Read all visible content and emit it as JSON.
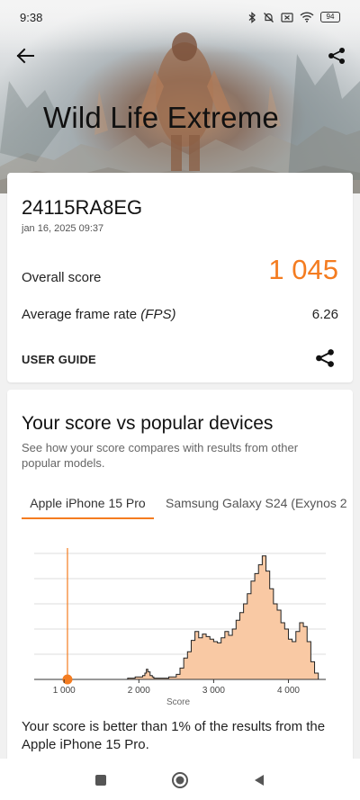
{
  "status_bar": {
    "time": "9:38",
    "battery": "94"
  },
  "header": {
    "title": "Wild Life Extreme"
  },
  "score_card": {
    "device": "24115RA8EG",
    "date": "jan 16, 2025 09:37",
    "overall_label": "Overall score",
    "overall_value": "1 045",
    "fps_label": "Average frame rate ",
    "fps_label_em": "(FPS)",
    "fps_value": "6.26",
    "user_guide": "USER GUIDE"
  },
  "compare": {
    "title": "Your score vs popular devices",
    "description": "See how your score compares with results from other popular models.",
    "tabs": [
      "Apple iPhone 15 Pro",
      "Samsung Galaxy S24 (Exynos 2"
    ],
    "active_tab": 0,
    "result_text": "Your score is better than 1% of the results from the Apple iPhone 15 Pro."
  },
  "colors": {
    "accent": "#f47c20",
    "fill": "#f9c9a4",
    "grid": "#dddddd"
  },
  "chart_data": {
    "type": "area",
    "xlabel": "Score",
    "ylabel": "",
    "xlim": [
      600,
      4500
    ],
    "ylim": [
      0,
      100
    ],
    "ticks": [
      1000,
      2000,
      3000,
      4000
    ],
    "tick_labels": [
      "1 000",
      "2 000",
      "3 000",
      "4 000"
    ],
    "grid": true,
    "marker": {
      "x": 1045
    },
    "x": [
      600,
      1000,
      1500,
      1800,
      1850,
      1900,
      1950,
      2000,
      2050,
      2080,
      2100,
      2120,
      2150,
      2180,
      2200,
      2250,
      2300,
      2350,
      2400,
      2500,
      2550,
      2600,
      2650,
      2700,
      2750,
      2800,
      2850,
      2900,
      2950,
      3000,
      3050,
      3100,
      3150,
      3200,
      3250,
      3300,
      3350,
      3400,
      3450,
      3500,
      3550,
      3600,
      3650,
      3700,
      3750,
      3800,
      3850,
      3900,
      3950,
      4000,
      4050,
      4100,
      4150,
      4200,
      4250,
      4300,
      4350,
      4400
    ],
    "values": [
      0,
      0,
      0,
      0,
      1,
      1,
      2,
      2,
      3,
      5,
      8,
      6,
      3,
      2,
      1,
      1,
      1,
      1,
      2,
      4,
      9,
      17,
      22,
      31,
      38,
      33,
      36,
      34,
      32,
      30,
      29,
      33,
      38,
      35,
      40,
      47,
      53,
      60,
      68,
      78,
      84,
      91,
      98,
      86,
      72,
      60,
      55,
      45,
      40,
      32,
      30,
      38,
      45,
      42,
      30,
      14,
      5,
      0
    ]
  }
}
